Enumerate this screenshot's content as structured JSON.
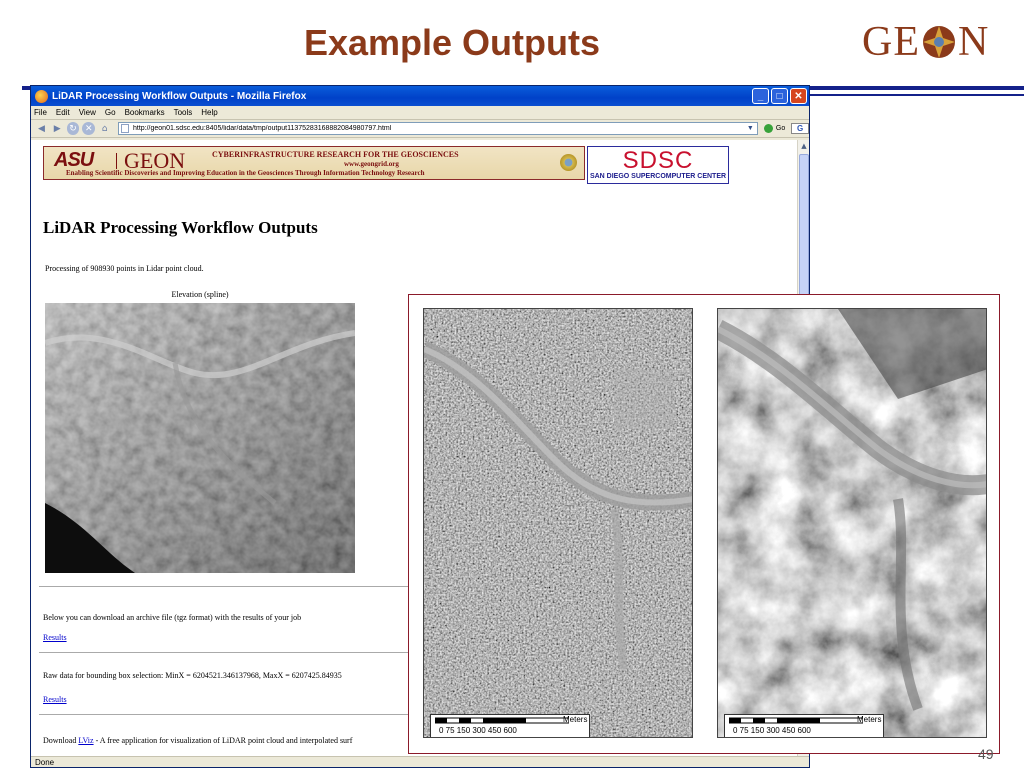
{
  "slide": {
    "title": "Example Outputs",
    "logo_text": "GEON",
    "page_number": "49"
  },
  "window": {
    "title": "LiDAR Processing Workflow Outputs - Mozilla Firefox",
    "menus": [
      "File",
      "Edit",
      "View",
      "Go",
      "Bookmarks",
      "Tools",
      "Help"
    ],
    "url": "http://geon01.sdsc.edu:8405/lidar/data/tmp/output11375283168882084980797.html",
    "go_label": "Go",
    "status": "Done"
  },
  "banner": {
    "asu": "ASU",
    "geon": "GEON",
    "cyber_title": "CYBERINFRASTRUCTURE RESEARCH FOR THE GEOSCIENCES",
    "geongrid": "www.geongrid.org",
    "tagline": "Enabling Scientific Discoveries and Improving Education in the Geosciences Through Information Technology Research",
    "sdsc": "SDSC",
    "sdsc_sub": "SAN DIEGO SUPERCOMPUTER CENTER"
  },
  "page": {
    "heading": "LiDAR Processing Workflow Outputs",
    "processing": "Processing of 908930 points in Lidar point cloud.",
    "elevation_label": "Elevation (spline)",
    "download_text": "Below you can download an archive file (tgz format) with the results of your job",
    "results_link_1": "Results",
    "raw_text": "Raw data for bounding box selection: MinX = 6204521.346137968, MaxX = 6207425.84935",
    "results_link_2": "Results",
    "download_prefix": "Download ",
    "lviz_link": "LViz",
    "download_suffix": " - A free application for visualization of LiDAR point cloud and interpolated surf"
  },
  "scale_bar": {
    "ticks": "0   75  150        300        450        600",
    "unit": "Meters"
  },
  "colors": {
    "title": "#8b3a1a",
    "rule": "#14218a",
    "link": "#0000cc",
    "overlay_border": "#8b1a2a"
  }
}
